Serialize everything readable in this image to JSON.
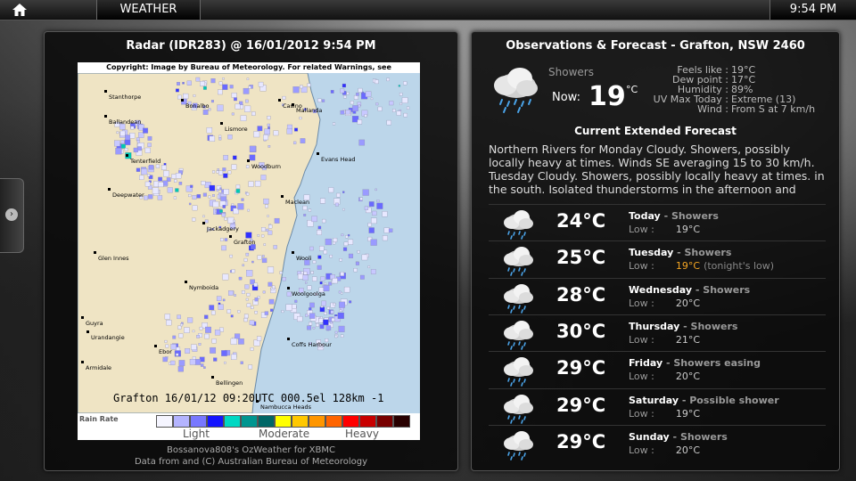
{
  "topbar": {
    "section_title": "WEATHER",
    "time": "9:54 PM",
    "home_icon": "home-icon"
  },
  "radar_panel": {
    "title": "Radar (IDR283) @ 16/01/2012 9:54 PM",
    "copyright": "Copyright: Image by Bureau of Meteorology. For related Warnings, see www.bom.gov.au",
    "footer_line": "Grafton 16/01/12 09:20UTC 000.5el 128km -1",
    "rain_rate_label": "Rain Rate",
    "scale_labels": {
      "light": "Light",
      "moderate": "Moderate",
      "heavy": "Heavy"
    },
    "scale_colors": [
      "#f5f5ff",
      "#b4b4ff",
      "#7878ff",
      "#1414ff",
      "#00d8c3",
      "#009690",
      "#006666",
      "#ffff00",
      "#ffc800",
      "#ff9600",
      "#ff6400",
      "#ff0000",
      "#c80000",
      "#780000",
      "#280000"
    ],
    "towns": [
      "Stanthorpe",
      "Ballandean",
      "Bonalbo",
      "Casino",
      "Mallanda",
      "Lismore",
      "Evans Head",
      "Tenterfield",
      "Woodburn",
      "Deepwater",
      "Maclean",
      "Jackadgery",
      "Grafton",
      "Glen Innes",
      "Wooli",
      "Nymboida",
      "Woolgoolga",
      "Guyra",
      "Urandangie",
      "Ebor",
      "Coffs Harbour",
      "Armidale",
      "Bellingen",
      "Nambucca Heads"
    ],
    "credit_1": "Bossanova808's OzWeather for XBMC",
    "credit_2": "Data from and (C) Australian Bureau of Meteorology"
  },
  "observations": {
    "title": "Observations & Forecast - Grafton, NSW 2460",
    "condition": "Showers",
    "now_label": "Now:",
    "now_temp": "19",
    "now_unit": "°C",
    "stats": [
      {
        "k": "Feels like :",
        "v": "19°C"
      },
      {
        "k": "Dew point :",
        "v": "17°C"
      },
      {
        "k": "Humidity :",
        "v": "89%"
      },
      {
        "k": "UV Max Today :",
        "v": "Extreme (13)"
      },
      {
        "k": "Wind :",
        "v": "From S at 7 km/h"
      }
    ],
    "forecast_heading": "Current Extended Forecast",
    "forecast_text": "Northern Rivers for Monday Cloudy. Showers, possibly locally heavy at times. Winds SE averaging 15 to 30 km/h. Tuesday Cloudy. Showers, possibly locally heavy at times. in the south. Isolated thunderstorms in the afternoon and",
    "low_label": "Low :",
    "days": [
      {
        "day": "Today",
        "summary": "Showers",
        "high": "24°C",
        "low": "19°C",
        "note": ""
      },
      {
        "day": "Tuesday",
        "summary": "Showers",
        "high": "25°C",
        "low": "19°C",
        "note": "(tonight's low)"
      },
      {
        "day": "Wednesday",
        "summary": "Showers",
        "high": "28°C",
        "low": "20°C",
        "note": ""
      },
      {
        "day": "Thursday",
        "summary": "Showers",
        "high": "30°C",
        "low": "21°C",
        "note": ""
      },
      {
        "day": "Friday",
        "summary": "Showers easing",
        "high": "29°C",
        "low": "20°C",
        "note": ""
      },
      {
        "day": "Saturday",
        "summary": "Possible shower",
        "high": "29°C",
        "low": "19°C",
        "note": ""
      },
      {
        "day": "Sunday",
        "summary": "Showers",
        "high": "29°C",
        "low": "20°C",
        "note": ""
      }
    ]
  }
}
